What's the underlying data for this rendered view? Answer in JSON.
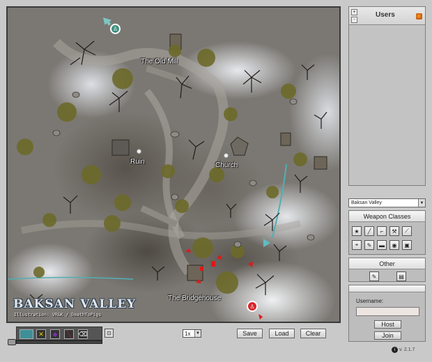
{
  "map": {
    "labels": {
      "old_mill": "The Old Mill",
      "ruin": "Ruin",
      "church": "Church",
      "bridgehouse": "The Bridgehouse"
    },
    "logo_title": "BAKSAN VALLEY",
    "credits": "Illustration: VR&K / DeathToPigs"
  },
  "toolbar": {
    "colors": {
      "teal_swatch": "#3f8f98",
      "yellow_tool": "#e6d000",
      "purple_tool": "#7a2fb0",
      "red_tool": "#c0202a"
    },
    "icons": [
      "color-swatch-icon",
      "cross-icon",
      "shape-icon",
      "line-icon",
      "eraser-icon"
    ],
    "lock_icon": "lock-icon",
    "zoom_value": "1x",
    "save_label": "Save",
    "load_label": "Load",
    "clear_label": "Clear"
  },
  "users": {
    "title": "Users",
    "plus_label": "+",
    "minus_label": "-"
  },
  "map_select": {
    "value": "Baksan Valley"
  },
  "weapons": {
    "title": "Weapon Classes",
    "icons": [
      "star-icon",
      "knife-icon",
      "pistol-icon",
      "rifle-icon",
      "sniper-icon",
      "crosshair-icon",
      "grenade-icon",
      "smg-icon",
      "mine-icon",
      "binoculars-icon"
    ],
    "glyphs": [
      "★",
      "╱",
      "⌐",
      "⚒",
      "⟋",
      "⌖",
      "✎",
      "▬",
      "◉",
      "▣"
    ]
  },
  "other": {
    "title": "Other",
    "icons": [
      "pen-icon",
      "document-icon"
    ]
  },
  "login": {
    "username_label": "Username:",
    "username_value": "",
    "host_label": "Host",
    "join_label": "Join"
  },
  "version": "v. 2.1.7",
  "accent_colors": {
    "marker_red": "#e01818",
    "route_teal": "#4fb0b5",
    "tree_olive": "#6d6a2a"
  }
}
